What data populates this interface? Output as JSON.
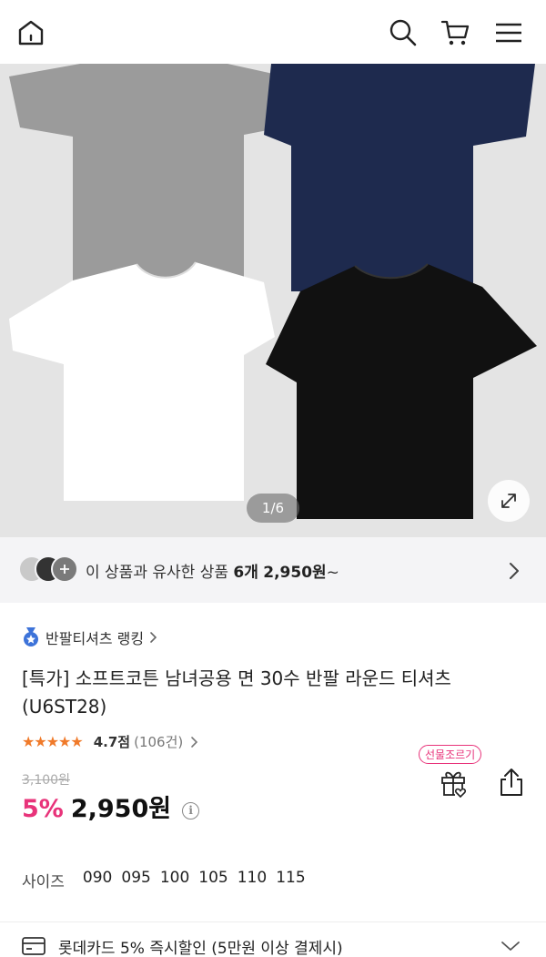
{
  "header": {
    "icons": [
      "home-icon",
      "search-icon",
      "cart-icon",
      "menu-icon"
    ]
  },
  "gallery": {
    "pager": "1/6",
    "colors": [
      "#9a9a9a",
      "#1e2a4e",
      "#ffffff",
      "#111111"
    ]
  },
  "similar": {
    "prefix": "이 상품과 유사한 상품 ",
    "count": "6개",
    "price": "2,950원",
    "suffix": "~"
  },
  "product": {
    "ranking": "반팔티셔츠 랭킹",
    "title": "[특가] 소프트코튼 남녀공용 면 30수 반팔 라운드 티셔츠(U6ST28)",
    "stars": "★★★★★",
    "score": "4.7점",
    "review_count": "(106건)",
    "original_price": "3,100원",
    "discount": "5%",
    "price": "2,950원",
    "info_icon": "i",
    "gift_label": "선물조르기"
  },
  "sizes": {
    "label": "사이즈",
    "options": [
      "090",
      "095",
      "100",
      "105",
      "110",
      "115"
    ]
  },
  "promo": {
    "text": "롯데카드 5% 즉시할인 (5만원 이상 결제시)"
  },
  "accent": "#e8337a"
}
